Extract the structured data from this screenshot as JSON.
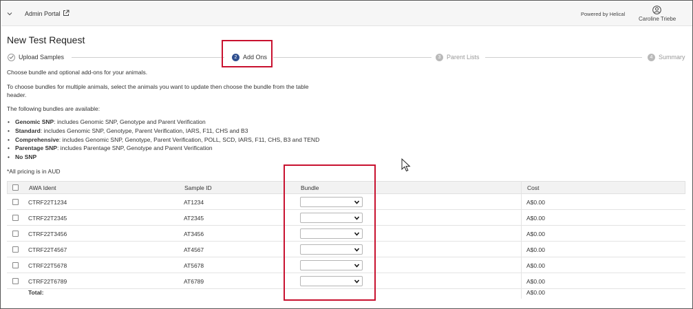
{
  "header": {
    "portal_title": "Admin Portal",
    "powered_by": "Powered by Helical",
    "user_name": "Caroline Triebe"
  },
  "page_title": "New Test Request",
  "stepper": {
    "steps": [
      {
        "number": "1",
        "label": "Upload Samples",
        "state": "done"
      },
      {
        "number": "2",
        "label": "Add Ons",
        "state": "active"
      },
      {
        "number": "3",
        "label": "Parent Lists",
        "state": "todo"
      },
      {
        "number": "4",
        "label": "Summary",
        "state": "todo"
      }
    ]
  },
  "intro": {
    "line1": "Choose bundle and optional add-ons for your animals.",
    "line2": "To choose bundles for multiple animals, select the animals you want to update then choose the bundle from the table header.",
    "line3": "The following bundles are available:"
  },
  "bundles": [
    {
      "name": "Genomic SNP",
      "desc": ": includes Genomic SNP, Genotype and Parent Verification"
    },
    {
      "name": "Standard",
      "desc": ": includes Genomic SNP, Genotype, Parent Verification, IARS, F11, CHS and B3"
    },
    {
      "name": "Comprehensive",
      "desc": ": includes Genomic SNP, Genotype, Parent Verification, POLL, SCD, IARS, F11, CHS, B3 and TEND"
    },
    {
      "name": "Parentage SNP",
      "desc": ": includes Parentage SNP, Genotype and Parent Verification"
    },
    {
      "name": "No SNP",
      "desc": ""
    }
  ],
  "pricing_note": "*All pricing is in AUD",
  "table": {
    "headers": {
      "awa": "AWA Ident",
      "sample": "Sample ID",
      "bundle": "Bundle",
      "cost": "Cost"
    },
    "rows": [
      {
        "awa": "CTRF22T1234",
        "sample": "AT1234",
        "bundle": "",
        "cost": "A$0.00"
      },
      {
        "awa": "CTRF22T2345",
        "sample": "AT2345",
        "bundle": "",
        "cost": "A$0.00"
      },
      {
        "awa": "CTRF22T3456",
        "sample": "AT3456",
        "bundle": "",
        "cost": "A$0.00"
      },
      {
        "awa": "CTRF22T4567",
        "sample": "AT4567",
        "bundle": "",
        "cost": "A$0.00"
      },
      {
        "awa": "CTRF22T5678",
        "sample": "AT5678",
        "bundle": "",
        "cost": "A$0.00"
      },
      {
        "awa": "CTRF22T6789",
        "sample": "AT6789",
        "bundle": "",
        "cost": "A$0.00"
      }
    ],
    "total_label": "Total:",
    "total_value": "A$0.00"
  },
  "colors": {
    "highlight": "#c8102e",
    "active_step": "#2f4f8f"
  }
}
